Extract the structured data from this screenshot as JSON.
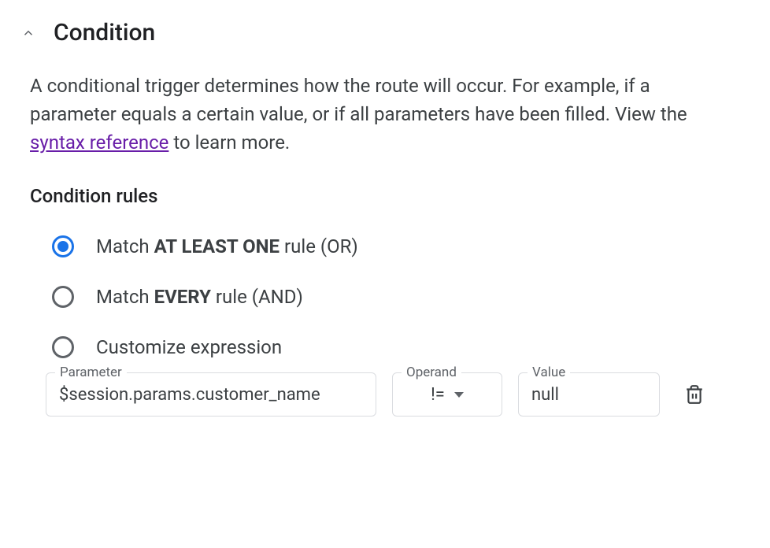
{
  "section": {
    "title": "Condition",
    "description_pre": "A conditional trigger determines how the route will occur. For example, if a parameter equals a certain value, or if all parameters have been filled. View the ",
    "description_link": "syntax reference",
    "description_post": " to learn more.",
    "rules_label": "Condition rules"
  },
  "radios": {
    "or": {
      "pre": "Match ",
      "bold": "AT LEAST ONE",
      "post": " rule (OR)",
      "selected": true
    },
    "and": {
      "pre": "Match ",
      "bold": "EVERY",
      "post": " rule (AND)",
      "selected": false
    },
    "custom": {
      "pre": "",
      "bold": "",
      "post": "Customize expression",
      "selected": false
    }
  },
  "rule": {
    "parameter_label": "Parameter",
    "parameter_value": "$session.params.customer_name",
    "operand_label": "Operand",
    "operand_value": "!=",
    "value_label": "Value",
    "value_value": "null"
  }
}
